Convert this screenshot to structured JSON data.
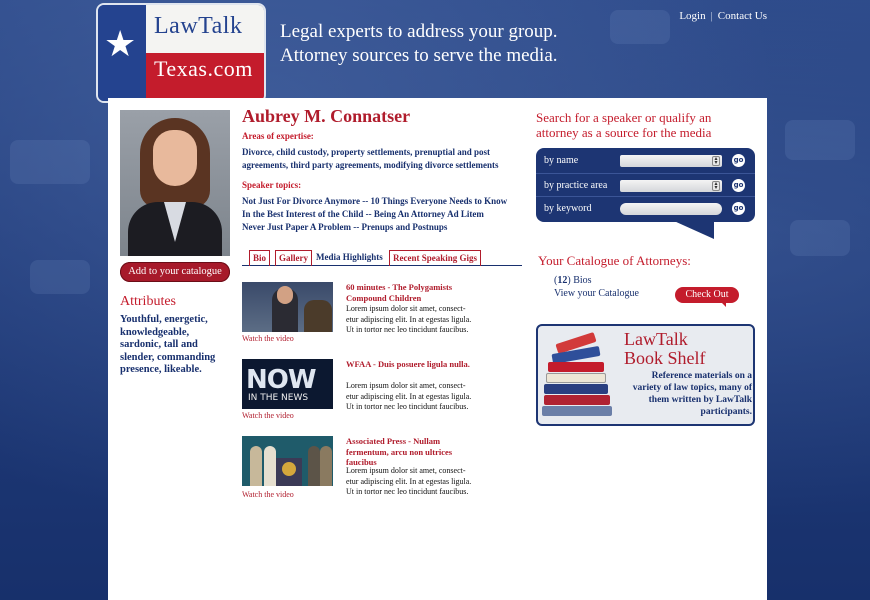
{
  "logo": {
    "line1": "LawTalk",
    "line2": "Texas.com",
    "star": "★"
  },
  "tagline": {
    "line1": "Legal experts to address your group.",
    "line2": "Attorney sources to serve the media."
  },
  "topnav": {
    "login": "Login",
    "separator": "|",
    "contact": "Contact Us"
  },
  "profile": {
    "name": "Aubrey M. Connatser",
    "areas_label": "Areas of expertise:",
    "areas_text": "Divorce, child custody, property settlements, prenuptial and post agreements, third party agreements, modifying divorce settlements",
    "topics_label": "Speaker topics:",
    "topics": [
      "Not Just For Divorce Anymore -- 10 Things Everyone Needs to Know",
      "In the Best Interest of the Child -- Being An Attorney Ad Litem",
      "Never Just Paper A Problem -- Prenups and Postnups"
    ],
    "add_button": "Add to your catalogue",
    "attributes_title": "Attributes",
    "attributes_text": "Youthful, energetic, knowledgeable, sardonic, tall and slender, commanding presence, likeable."
  },
  "tabs": [
    {
      "label": "Bio"
    },
    {
      "label": "Gallery"
    },
    {
      "label": "Media Highlights"
    },
    {
      "label": "Recent Speaking Gigs"
    }
  ],
  "media": [
    {
      "title": "60 minutes -  The  Polygamists Compound Children",
      "body": "Lorem ipsum dolor sit amet, consect-etur adipiscing elit. In at egestas ligula. Ut in tortor nec leo tincidunt faucibus.",
      "watch": "Watch the video"
    },
    {
      "title": "WFAA -  Duis posuere ligula nulla.",
      "body": "Lorem ipsum dolor sit amet, consect-etur adipiscing elit. In at egestas ligula. Ut in tortor nec leo tincidunt faucibus.",
      "watch": "Watch the video",
      "thumb_text1": "NOW",
      "thumb_text2": "IN THE NEWS"
    },
    {
      "title": "Associated Press -  Nullam fermentum, arcu non ultrices faucibus",
      "body": "Lorem ipsum dolor sit amet, consect-etur adipiscing elit. In at egestas ligula. Ut in tortor nec leo tincidunt faucibus.",
      "watch": "Watch the video"
    }
  ],
  "search": {
    "title": "Search for a speaker or qualify an attorney as a source for the media",
    "rows": [
      {
        "label": "by name",
        "go": "go"
      },
      {
        "label": "by practice area",
        "go": "go"
      },
      {
        "label": "by keyword",
        "go": "go"
      }
    ]
  },
  "catalogue": {
    "title": "Your Catalogue of Attorneys:",
    "count": "12",
    "count_suffix": "Bios",
    "view_link": "View your Catalogue",
    "checkout": "Check Out"
  },
  "bookshelf": {
    "title_line1": "LawTalk",
    "title_line2": "Book Shelf",
    "text": "Reference materials on a variety of law topics, many of them written by LawTalk participants."
  },
  "colors": {
    "brand_red": "#c41c2c",
    "brand_navy": "#1d3573",
    "background": "#223d7c"
  }
}
